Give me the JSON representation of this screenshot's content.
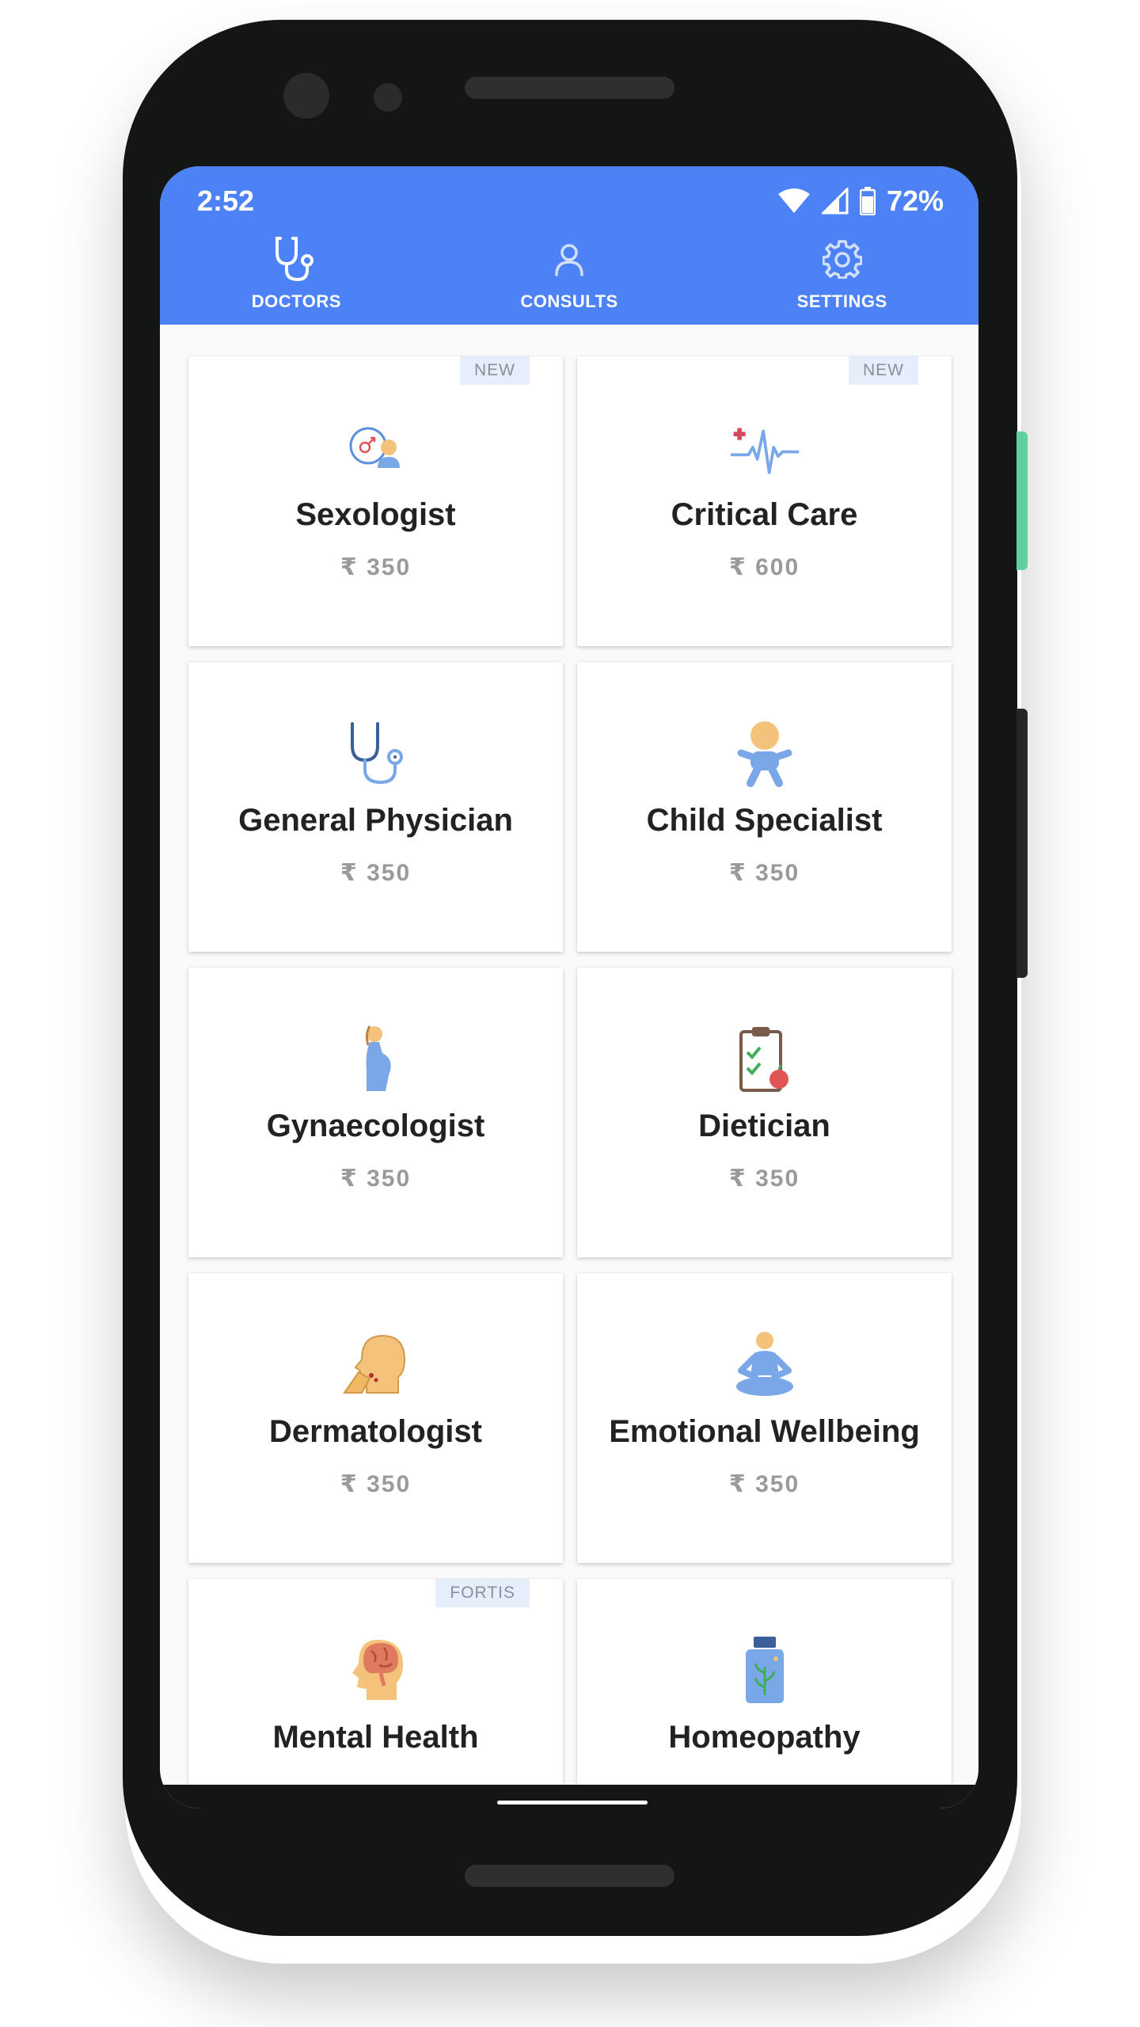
{
  "status": {
    "time": "2:52",
    "battery": "72%"
  },
  "tabs": [
    {
      "label": "DOCTORS",
      "icon": "stethoscope-icon",
      "active": true
    },
    {
      "label": "CONSULTS",
      "icon": "person-icon",
      "active": false
    },
    {
      "label": "SETTINGS",
      "icon": "gear-icon",
      "active": false
    }
  ],
  "cards": [
    {
      "title": "Sexologist",
      "price": "₹ 350",
      "badge": "NEW",
      "icon": "sexologist-icon"
    },
    {
      "title": "Critical Care",
      "price": "₹ 600",
      "badge": "NEW",
      "icon": "heartbeat-icon"
    },
    {
      "title": "General Physician",
      "price": "₹ 350",
      "badge": "",
      "icon": "stethoscope-icon"
    },
    {
      "title": "Child Specialist",
      "price": "₹ 350",
      "badge": "",
      "icon": "baby-icon"
    },
    {
      "title": "Gynaecologist",
      "price": "₹ 350",
      "badge": "",
      "icon": "pregnant-woman-icon"
    },
    {
      "title": "Dietician",
      "price": "₹ 350",
      "badge": "",
      "icon": "clipboard-apple-icon"
    },
    {
      "title": "Dermatologist",
      "price": "₹ 350",
      "badge": "",
      "icon": "face-skin-icon"
    },
    {
      "title": "Emotional Wellbeing",
      "price": "₹ 350",
      "badge": "",
      "icon": "meditation-icon"
    },
    {
      "title": "Mental Health",
      "price": "",
      "badge": "FORTIS",
      "icon": "brain-head-icon"
    },
    {
      "title": "Homeopathy",
      "price": "",
      "badge": "",
      "icon": "medicine-bottle-icon"
    }
  ],
  "colors": {
    "primary": "#4d82f7",
    "badge_bg": "#e6eefc",
    "price": "#9a9a9a",
    "title": "#222222"
  }
}
